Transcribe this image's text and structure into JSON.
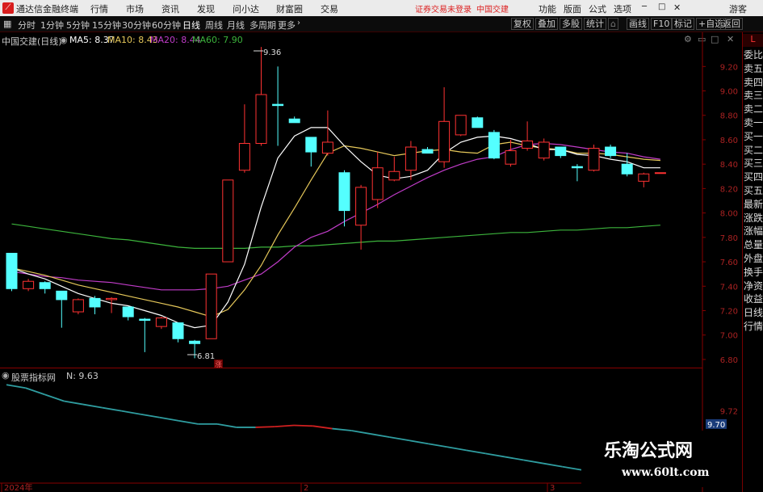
{
  "menubar": {
    "app_title": "通达信金融终端",
    "items": [
      "行情",
      "市场",
      "资讯",
      "发现",
      "问小达",
      "财富圈",
      "交易"
    ],
    "status_notice": "证券交易未登录",
    "stock_name": "中国交建",
    "right_items": [
      "功能",
      "版面",
      "公式",
      "选项"
    ],
    "user": "游客"
  },
  "toolbar": {
    "periods": [
      "分时",
      "1分钟",
      "5分钟",
      "15分钟",
      "30分钟",
      "60分钟",
      "日线",
      "周线",
      "月线",
      "多周期",
      "更多"
    ],
    "active_period": "日线",
    "right_buttons": [
      "复权",
      "叠加",
      "多股",
      "统计",
      "画线",
      "F10",
      "标记",
      "+自选",
      "返回"
    ]
  },
  "main_panel": {
    "title": "中国交建(日线)",
    "ma5_label": "MA5: 8.37",
    "ma10_label": "MA10: 8.43",
    "ma20_label": "MA20: 8.44",
    "ma60_label": "MA60: 7.90",
    "high_marker": "9.36",
    "low_marker": "6.81",
    "event_marker": "涨"
  },
  "sub_panel": {
    "title": "股票指标网",
    "value_label": "N: 9.63",
    "current_value": "9.70",
    "axis_ticks": [
      "9.72",
      "9.70"
    ]
  },
  "date_axis": [
    "2024年",
    "2",
    "3"
  ],
  "sidebar": {
    "top_badge": "L",
    "items": [
      "委比",
      "卖五",
      "卖四",
      "卖三",
      "卖二",
      "卖一",
      "买一",
      "买二",
      "买三",
      "买四",
      "买五",
      "最新",
      "涨跌",
      "涨幅",
      "总量",
      "外盘",
      "换手",
      "净资",
      "收益",
      "日线",
      "行情"
    ]
  },
  "watermark": {
    "line1": "乐淘公式网",
    "line2": "www.60lt.com"
  },
  "colors": {
    "up": "#ff3232",
    "down": "#54ffff",
    "ma5": "#ffffff",
    "ma10": "#e6c85a",
    "ma20": "#c03cc8",
    "ma60": "#3cb43c",
    "indicator": "#2f9da0",
    "indicator_hot": "#d02020"
  },
  "chart_data": {
    "type": "candlestick",
    "title": "中国交建(日线)",
    "y_ticks": [
      9.2,
      9.0,
      8.8,
      8.6,
      8.4,
      8.2,
      8.0,
      7.8,
      7.6,
      7.4,
      7.2,
      7.0,
      6.8
    ],
    "ylim": [
      6.74,
      9.48
    ],
    "candles": [
      {
        "o": 7.67,
        "c": 7.38,
        "h": 7.67,
        "l": 7.36
      },
      {
        "o": 7.38,
        "c": 7.44,
        "h": 7.46,
        "l": 7.36
      },
      {
        "o": 7.43,
        "c": 7.38,
        "h": 7.44,
        "l": 7.34
      },
      {
        "o": 7.36,
        "c": 7.29,
        "h": 7.36,
        "l": 7.06
      },
      {
        "o": 7.19,
        "c": 7.29,
        "h": 7.3,
        "l": 7.17
      },
      {
        "o": 7.3,
        "c": 7.23,
        "h": 7.32,
        "l": 7.17
      },
      {
        "o": 7.29,
        "c": 7.3,
        "h": 7.31,
        "l": 7.18
      },
      {
        "o": 7.23,
        "c": 7.15,
        "h": 7.23,
        "l": 7.12
      },
      {
        "o": 7.13,
        "c": 7.12,
        "h": 7.14,
        "l": 6.86
      },
      {
        "o": 7.07,
        "c": 7.14,
        "h": 7.15,
        "l": 7.05
      },
      {
        "o": 7.1,
        "c": 6.97,
        "h": 7.1,
        "l": 6.94
      },
      {
        "o": 6.95,
        "c": 6.93,
        "h": 6.96,
        "l": 6.81
      },
      {
        "o": 6.97,
        "c": 7.5,
        "h": 7.5,
        "l": 6.97
      },
      {
        "o": 7.6,
        "c": 8.27,
        "h": 8.27,
        "l": 7.6
      },
      {
        "o": 8.35,
        "c": 8.57,
        "h": 8.89,
        "l": 8.33
      },
      {
        "o": 8.57,
        "c": 8.97,
        "h": 9.36,
        "l": 8.55
      },
      {
        "o": 8.89,
        "c": 8.88,
        "h": 9.2,
        "l": 8.55
      },
      {
        "o": 8.77,
        "c": 8.74,
        "h": 8.79,
        "l": 8.74
      },
      {
        "o": 8.62,
        "c": 8.5,
        "h": 8.62,
        "l": 8.38
      },
      {
        "o": 8.49,
        "c": 8.58,
        "h": 8.84,
        "l": 8.47
      },
      {
        "o": 8.33,
        "c": 8.02,
        "h": 8.35,
        "l": 7.89
      },
      {
        "o": 7.9,
        "c": 8.21,
        "h": 8.23,
        "l": 7.7
      },
      {
        "o": 8.11,
        "c": 8.37,
        "h": 8.5,
        "l": 8.04
      },
      {
        "o": 8.27,
        "c": 8.34,
        "h": 8.46,
        "l": 8.26
      },
      {
        "o": 8.35,
        "c": 8.54,
        "h": 8.59,
        "l": 8.27
      },
      {
        "o": 8.52,
        "c": 8.49,
        "h": 8.54,
        "l": 8.49
      },
      {
        "o": 8.42,
        "c": 8.75,
        "h": 9.03,
        "l": 8.37
      },
      {
        "o": 8.64,
        "c": 8.8,
        "h": 8.8,
        "l": 8.63
      },
      {
        "o": 8.78,
        "c": 8.7,
        "h": 8.79,
        "l": 8.7
      },
      {
        "o": 8.66,
        "c": 8.45,
        "h": 8.68,
        "l": 8.44
      },
      {
        "o": 8.4,
        "c": 8.51,
        "h": 8.6,
        "l": 8.38
      },
      {
        "o": 8.53,
        "c": 8.59,
        "h": 8.75,
        "l": 8.51
      },
      {
        "o": 8.45,
        "c": 8.58,
        "h": 8.61,
        "l": 8.43
      },
      {
        "o": 8.54,
        "c": 8.47,
        "h": 8.54,
        "l": 8.45
      },
      {
        "o": 8.38,
        "c": 8.37,
        "h": 8.4,
        "l": 8.26
      },
      {
        "o": 8.35,
        "c": 8.53,
        "h": 8.56,
        "l": 8.34
      },
      {
        "o": 8.54,
        "c": 8.47,
        "h": 8.56,
        "l": 8.45
      },
      {
        "o": 8.4,
        "c": 8.32,
        "h": 8.49,
        "l": 8.3
      },
      {
        "o": 8.26,
        "c": 8.32,
        "h": 8.33,
        "l": 8.21
      },
      {
        "o": 8.33,
        "c": 8.33,
        "h": 8.33,
        "l": 8.33
      }
    ],
    "ma5": [
      7.55,
      7.5,
      7.46,
      7.4,
      7.34,
      7.3,
      7.26,
      7.24,
      7.2,
      7.16,
      7.1,
      7.06,
      7.08,
      7.27,
      7.58,
      8.05,
      8.45,
      8.63,
      8.7,
      8.7,
      8.55,
      8.42,
      8.31,
      8.28,
      8.3,
      8.35,
      8.49,
      8.58,
      8.62,
      8.63,
      8.61,
      8.57,
      8.52,
      8.52,
      8.48,
      8.47,
      8.44,
      8.42,
      8.37,
      8.37
    ],
    "ma10": [
      7.55,
      7.52,
      7.49,
      7.45,
      7.41,
      7.38,
      7.35,
      7.32,
      7.29,
      7.26,
      7.23,
      7.19,
      7.15,
      7.21,
      7.37,
      7.57,
      7.82,
      8.04,
      8.27,
      8.49,
      8.55,
      8.53,
      8.5,
      8.47,
      8.49,
      8.51,
      8.52,
      8.5,
      8.49,
      8.56,
      8.58,
      8.55,
      8.53,
      8.52,
      8.49,
      8.49,
      8.48,
      8.46,
      8.44,
      8.43
    ],
    "ma20": [
      7.52,
      7.5,
      7.48,
      7.47,
      7.45,
      7.44,
      7.43,
      7.41,
      7.39,
      7.37,
      7.37,
      7.37,
      7.38,
      7.4,
      7.45,
      7.5,
      7.6,
      7.72,
      7.8,
      7.85,
      7.93,
      8.0,
      8.07,
      8.15,
      8.22,
      8.29,
      8.35,
      8.4,
      8.44,
      8.46,
      8.52,
      8.56,
      8.57,
      8.56,
      8.54,
      8.52,
      8.5,
      8.49,
      8.46,
      8.44
    ],
    "ma60": [
      7.91,
      7.89,
      7.87,
      7.85,
      7.83,
      7.81,
      7.79,
      7.78,
      7.76,
      7.74,
      7.72,
      7.71,
      7.71,
      7.71,
      7.71,
      7.72,
      7.72,
      7.73,
      7.73,
      7.74,
      7.75,
      7.76,
      7.77,
      7.77,
      7.78,
      7.79,
      7.8,
      7.81,
      7.82,
      7.83,
      7.84,
      7.84,
      7.85,
      7.86,
      7.86,
      7.87,
      7.88,
      7.88,
      7.89,
      7.9
    ],
    "indicator": [
      9.76,
      9.755,
      9.745,
      9.735,
      9.73,
      9.725,
      9.72,
      9.715,
      9.71,
      9.705,
      9.7,
      9.7,
      9.695,
      9.695,
      9.696,
      9.698,
      9.697,
      9.693,
      9.69,
      9.685,
      9.68,
      9.675,
      9.67,
      9.665,
      9.66,
      9.655,
      9.65,
      9.645,
      9.64,
      9.635,
      9.63
    ]
  }
}
